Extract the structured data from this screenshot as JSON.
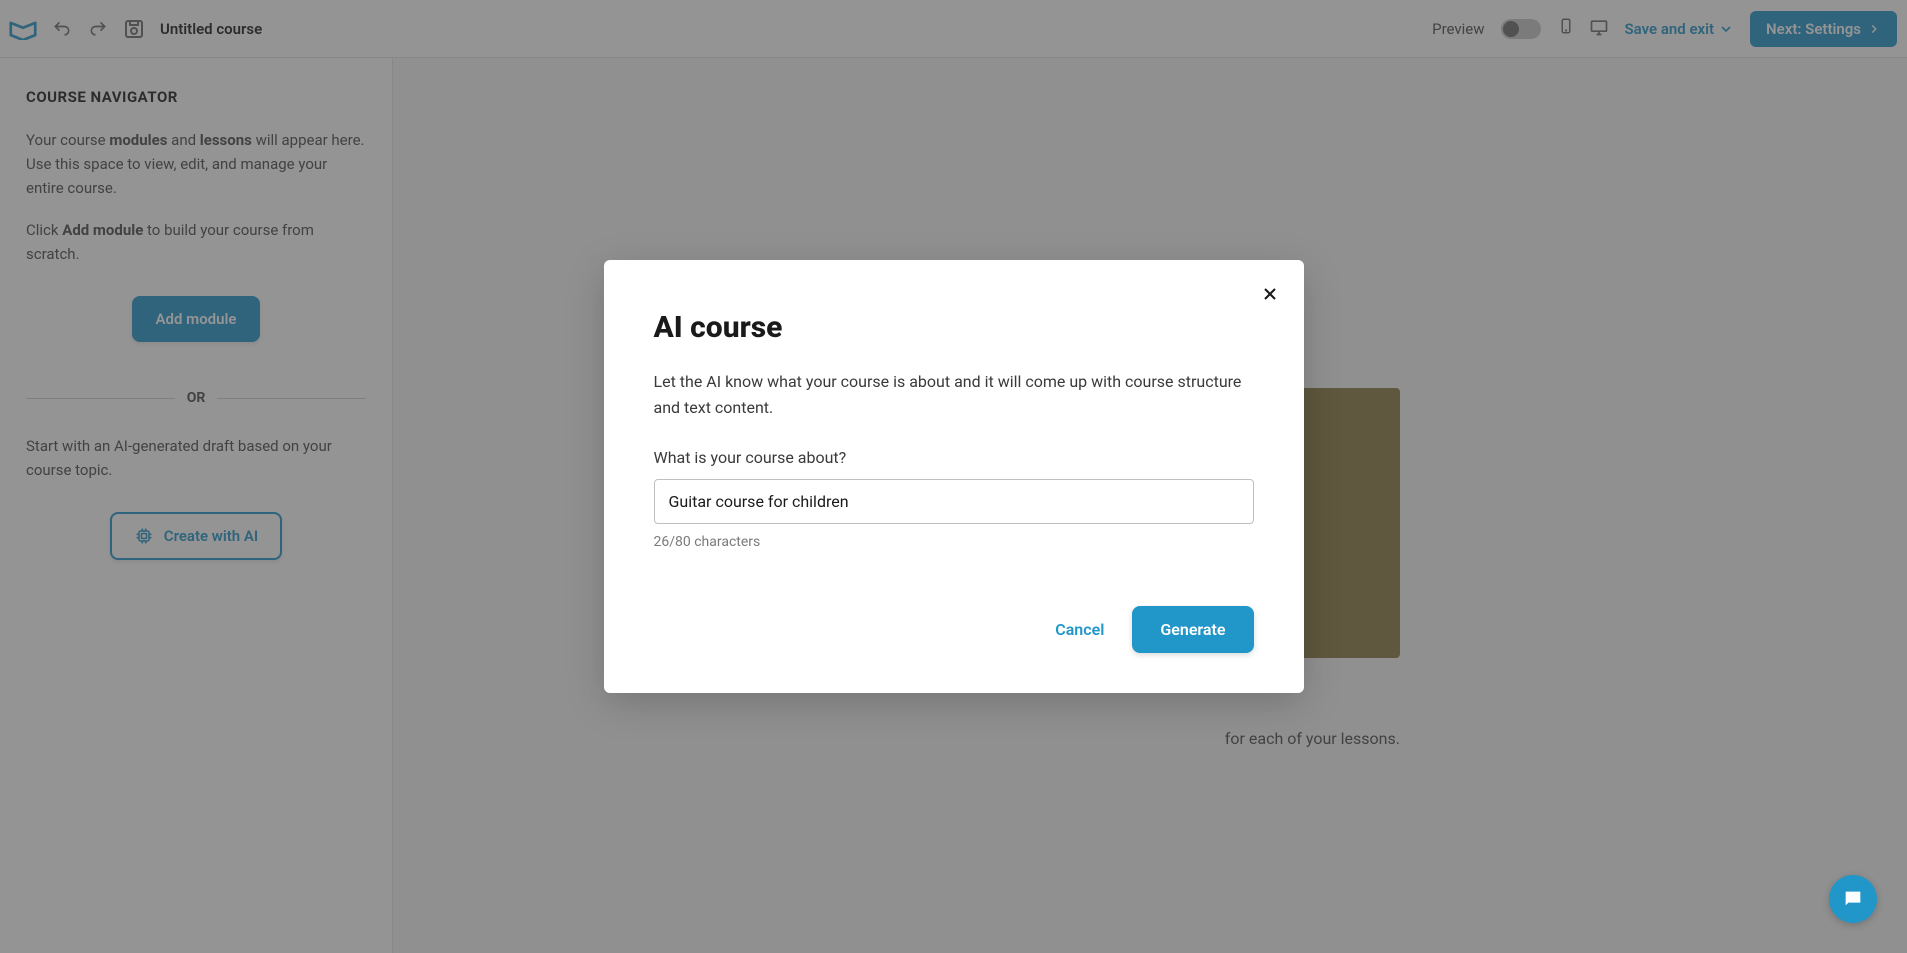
{
  "topbar": {
    "course_title": "Untitled course",
    "preview_label": "Preview",
    "save_exit_label": "Save and exit",
    "next_label": "Next: Settings"
  },
  "sidebar": {
    "title": "COURSE NAVIGATOR",
    "desc_part1": "Your course ",
    "desc_modules": "modules",
    "desc_and": " and ",
    "desc_lessons": "lessons",
    "desc_part2": " will appear here. Use this space to view, edit, and manage your entire course.",
    "desc2_part1": "Click ",
    "desc2_bold": "Add module",
    "desc2_part2": " to build your course from scratch.",
    "add_module_label": "Add module",
    "or_label": "OR",
    "ai_desc": "Start with an AI-generated draft based on your course topic.",
    "create_ai_label": "Create with AI"
  },
  "content": {
    "text_suffix": "for each of your lessons."
  },
  "modal": {
    "title": "AI course",
    "description": "Let the AI know what your course is about and it will come up with course structure and text content.",
    "input_label": "What is your course about?",
    "input_value": "Guitar course for children",
    "char_count": "26/80 characters",
    "cancel_label": "Cancel",
    "generate_label": "Generate"
  }
}
